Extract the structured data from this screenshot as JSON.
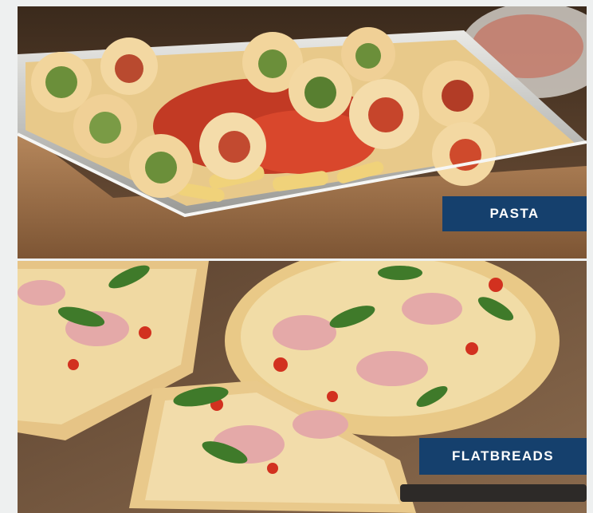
{
  "tiles": [
    {
      "label": "PASTA",
      "image": "pasta-tray-photo"
    },
    {
      "label": "FLATBREADS",
      "image": "flatbread-pizza-photo"
    }
  ],
  "colors": {
    "label_background": "#15406d",
    "label_text": "#ffffff",
    "page_background": "#eef0f0"
  }
}
